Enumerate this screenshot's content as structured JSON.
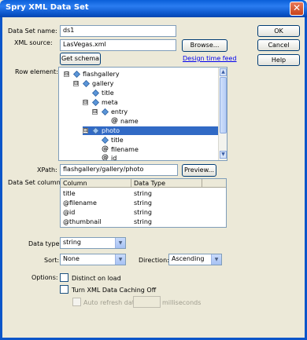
{
  "window": {
    "title": "Spry XML Data Set",
    "close_glyph": "✕"
  },
  "form": {
    "dataset_name_label": "Data Set name:",
    "dataset_name_value": "ds1",
    "xml_source_label": "XML source:",
    "xml_source_value": "LasVegas.xml",
    "browse_label": "Browse...",
    "get_schema_label": "Get schema",
    "design_time_feed_label": "Design time feed",
    "row_element_label": "Row element:",
    "xpath_label": "XPath:",
    "xpath_value": "flashgallery/gallery/photo",
    "preview_label": "Preview...",
    "columns_label": "Data Set columns:",
    "data_type_label": "Data type:",
    "data_type_value": "string",
    "sort_label": "Sort:",
    "sort_value": "None",
    "direction_label": "Direction:",
    "direction_value": "Ascending",
    "options_label": "Options:",
    "opt_distinct": "Distinct on load",
    "opt_caching": "Turn XML Data Caching Off",
    "opt_auto_refresh": "Auto refresh data",
    "opt_milliseconds": "milliseconds"
  },
  "tree": [
    {
      "label": "flashgallery",
      "expander": "⊟"
    },
    {
      "label": "gallery",
      "expander": "⊟"
    },
    {
      "label": "title",
      "expander": ""
    },
    {
      "label": "meta",
      "expander": "⊟"
    },
    {
      "label": "entry",
      "expander": "⊟"
    },
    {
      "label": "name",
      "expander": ""
    },
    {
      "label": "photo",
      "expander": "⊟"
    },
    {
      "label": "title",
      "expander": ""
    },
    {
      "label": "filename",
      "expander": ""
    },
    {
      "label": "id",
      "expander": ""
    }
  ],
  "columns_table": {
    "headers": [
      "Column",
      "Data Type"
    ],
    "rows": [
      [
        "title",
        "string"
      ],
      [
        "@filename",
        "string"
      ],
      [
        "@id",
        "string"
      ],
      [
        "@thumbnail",
        "string"
      ]
    ]
  },
  "buttons": {
    "ok": "OK",
    "cancel": "Cancel",
    "help": "Help"
  }
}
